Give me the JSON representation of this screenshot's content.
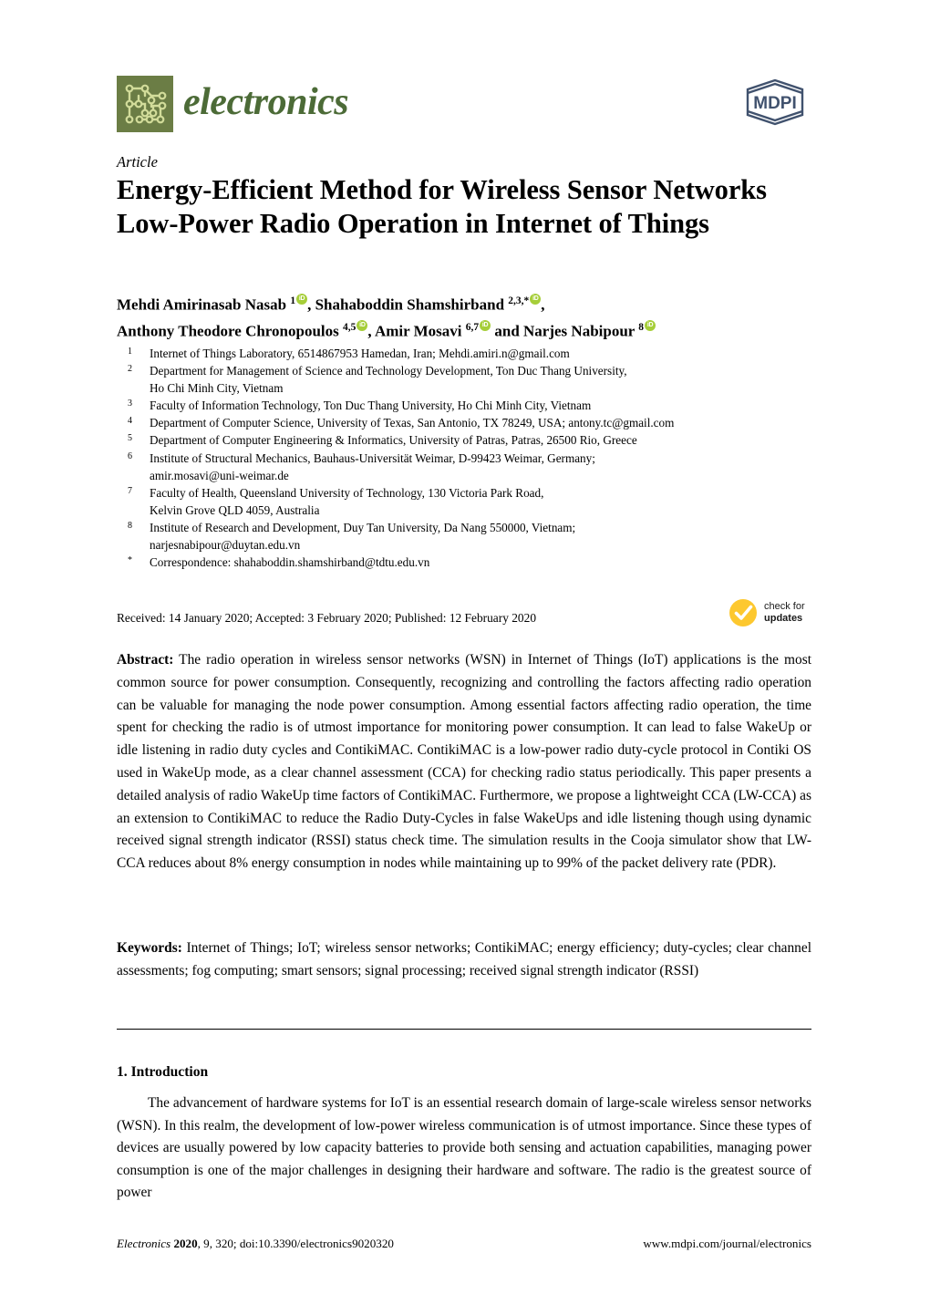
{
  "journal": {
    "logo_icon": "circuit-board-icon",
    "name": "electronics",
    "publisher_logo_text": "MDPI",
    "brand_green": "#4c6b37",
    "logo_tile_green": "#6b7d45"
  },
  "article": {
    "kicker": "Article",
    "title": "Energy-Efficient Method for Wireless Sensor Networks Low-Power Radio Operation in Internet of Things"
  },
  "authors": {
    "line1": [
      {
        "name": "Mehdi Amirinasab Nasab",
        "sup": "1",
        "orcid": true,
        "sep": ", "
      },
      {
        "name": "Shahaboddin Shamshirband",
        "sup": "2,3,*",
        "orcid": true,
        "sep": ","
      }
    ],
    "line2": [
      {
        "name": "Anthony Theodore Chronopoulos",
        "sup": "4,5",
        "orcid": true,
        "sep": ", "
      },
      {
        "name": "Amir Mosavi",
        "sup": "6,7",
        "orcid": true,
        "sep": " and "
      },
      {
        "name": "Narjes Nabipour",
        "sup": "8",
        "orcid": true,
        "sep": ""
      }
    ]
  },
  "affiliations": [
    {
      "num": "1",
      "lines": [
        "Internet of Things Laboratory, 6514867953 Hamedan, Iran; Mehdi.amiri.n@gmail.com"
      ]
    },
    {
      "num": "2",
      "lines": [
        "Department for Management of Science and Technology Development, Ton Duc Thang University,",
        "Ho Chi Minh City, Vietnam"
      ]
    },
    {
      "num": "3",
      "lines": [
        "Faculty of Information Technology, Ton Duc Thang University, Ho Chi Minh City, Vietnam"
      ]
    },
    {
      "num": "4",
      "lines": [
        "Department of Computer Science, University of Texas, San Antonio, TX 78249, USA; antony.tc@gmail.com"
      ]
    },
    {
      "num": "5",
      "lines": [
        "Department of Computer Engineering & Informatics, University of Patras, Patras, 26500 Rio, Greece"
      ]
    },
    {
      "num": "6",
      "lines": [
        "Institute of Structural Mechanics, Bauhaus-Universität Weimar, D-99423 Weimar, Germany;",
        "amir.mosavi@uni-weimar.de"
      ]
    },
    {
      "num": "7",
      "lines": [
        "Faculty of Health, Queensland University of Technology, 130 Victoria Park Road,",
        "Kelvin Grove QLD 4059, Australia"
      ]
    },
    {
      "num": "8",
      "lines": [
        "Institute of Research and Development, Duy Tan University, Da Nang 550000, Vietnam;",
        "narjesnabipour@duytan.edu.vn"
      ]
    },
    {
      "num": "*",
      "lines": [
        "Correspondence: shahaboddin.shamshirband@tdtu.edu.vn"
      ]
    }
  ],
  "dates": "Received: 14 January 2020; Accepted: 3 February 2020; Published: 12 February 2020",
  "check_for_updates": {
    "icon": "check-circle-icon",
    "line1": "check for",
    "line2": "updates",
    "color": "#FDC82F"
  },
  "abstract": {
    "label": "Abstract:",
    "text": "The radio operation in wireless sensor networks (WSN) in Internet of Things (IoT) applications is the most common source for power consumption. Consequently, recognizing and controlling the factors affecting radio operation can be valuable for managing the node power consumption. Among essential factors affecting radio operation, the time spent for checking the radio is of utmost importance for monitoring power consumption. It can lead to false WakeUp or idle listening in radio duty cycles and ContikiMAC. ContikiMAC is a low-power radio duty-cycle protocol in Contiki OS used in WakeUp mode, as a clear channel assessment (CCA) for checking radio status periodically. This paper presents a detailed analysis of radio WakeUp time factors of ContikiMAC. Furthermore, we propose a lightweight CCA (LW-CCA) as an extension to ContikiMAC to reduce the Radio Duty-Cycles in false WakeUps and idle listening though using dynamic received signal strength indicator (RSSI) status check time. The simulation results in the Cooja simulator show that LW-CCA reduces about 8% energy consumption in nodes while maintaining up to 99% of the packet delivery rate (PDR)."
  },
  "keywords": {
    "label": "Keywords:",
    "text": "Internet of Things; IoT; wireless sensor networks; ContikiMAC; energy efficiency; duty-cycles; clear channel assessments; fog computing; smart sensors; signal processing; received signal strength indicator (RSSI)"
  },
  "section": {
    "heading": "1. Introduction",
    "paragraph": "The advancement of hardware systems for IoT is an essential research domain of large-scale wireless sensor networks (WSN). In this realm, the development of low-power wireless communication is of utmost importance. Since these types of devices are usually powered by low capacity batteries to provide both sensing and actuation capabilities, managing power consumption is one of the major challenges in designing their hardware and software. The radio is the greatest source of power"
  },
  "footer": {
    "journal_italic": "Electronics",
    "year": "2020",
    "volume_issue": ", 9, 320; doi:10.3390/electronics9020320",
    "url": "www.mdpi.com/journal/electronics"
  }
}
